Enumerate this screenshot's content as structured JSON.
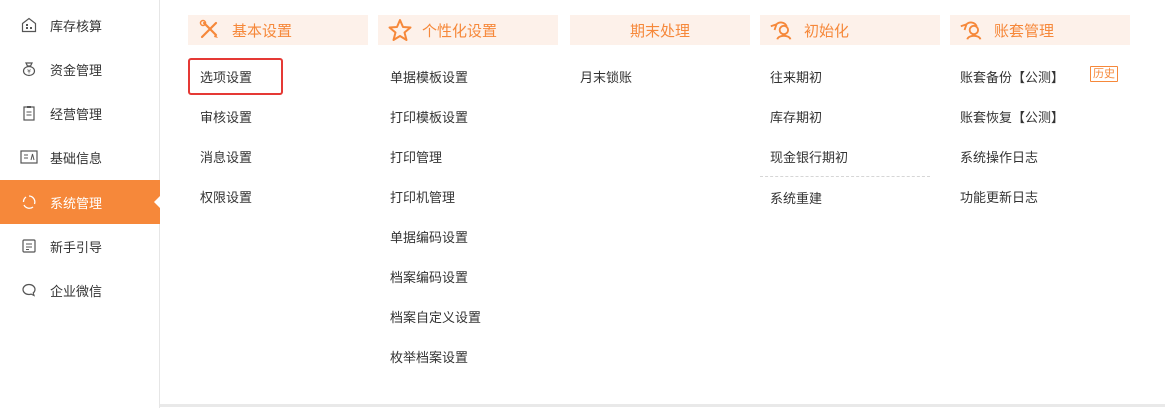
{
  "colors": {
    "accent": "#f6883a",
    "header_bg": "#fdf1ea",
    "selected_border": "#e53935"
  },
  "sidebar": {
    "items": [
      {
        "label": "库存核算",
        "icon": "warehouse-icon"
      },
      {
        "label": "资金管理",
        "icon": "money-bag-icon"
      },
      {
        "label": "经营管理",
        "icon": "clipboard-icon"
      },
      {
        "label": "基础信息",
        "icon": "id-card-icon"
      },
      {
        "label": "系统管理",
        "icon": "cycle-icon",
        "active": true
      },
      {
        "label": "新手引导",
        "icon": "guide-book-icon"
      },
      {
        "label": "企业微信",
        "icon": "chat-bubble-icon"
      }
    ]
  },
  "columns": [
    {
      "title": "基本设置",
      "icon": "wrench-pencil-icon",
      "items": [
        "选项设置",
        "审核设置",
        "消息设置",
        "权限设置"
      ]
    },
    {
      "title": "个性化设置",
      "icon": "star-icon",
      "items": [
        "单据模板设置",
        "打印模板设置",
        "打印管理",
        "打印机管理",
        "单据编码设置",
        "档案编码设置",
        "档案自定义设置",
        "枚举档案设置"
      ]
    },
    {
      "title": "期末处理",
      "items": [
        "月末锁账"
      ]
    },
    {
      "title": "初始化",
      "icon": "refresh-person-icon",
      "items": [
        "往来期初",
        "库存期初",
        "现金银行期初",
        "系统重建"
      ]
    },
    {
      "title": "账套管理",
      "icon": "refresh-person-icon",
      "items": [
        "账套备份【公测】",
        "账套恢复【公测】",
        "系统操作日志",
        "功能更新日志"
      ],
      "badge": "历史"
    }
  ]
}
